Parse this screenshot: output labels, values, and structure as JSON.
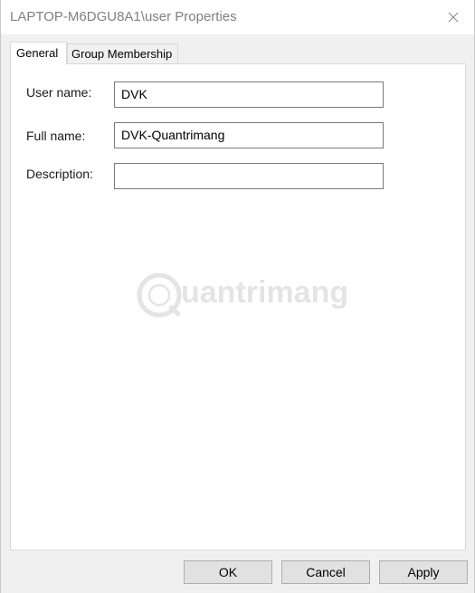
{
  "window": {
    "title": "LAPTOP-M6DGU8A1\\user Properties"
  },
  "tabs": [
    {
      "label": "General",
      "selected": true
    },
    {
      "label": "Group Membership",
      "selected": false
    }
  ],
  "form": {
    "user_name": {
      "label": "User name:",
      "value": "DVK"
    },
    "full_name": {
      "label": "Full name:",
      "value": "DVK-Quantrimang"
    },
    "description": {
      "label": "Description:",
      "value": ""
    }
  },
  "watermark": {
    "text": "uantrimang"
  },
  "buttons": {
    "ok": "OK",
    "cancel": "Cancel",
    "apply": "Apply"
  },
  "icons": {
    "close": "close-icon",
    "watermark_logo": "quantrimang-logo-icon"
  }
}
